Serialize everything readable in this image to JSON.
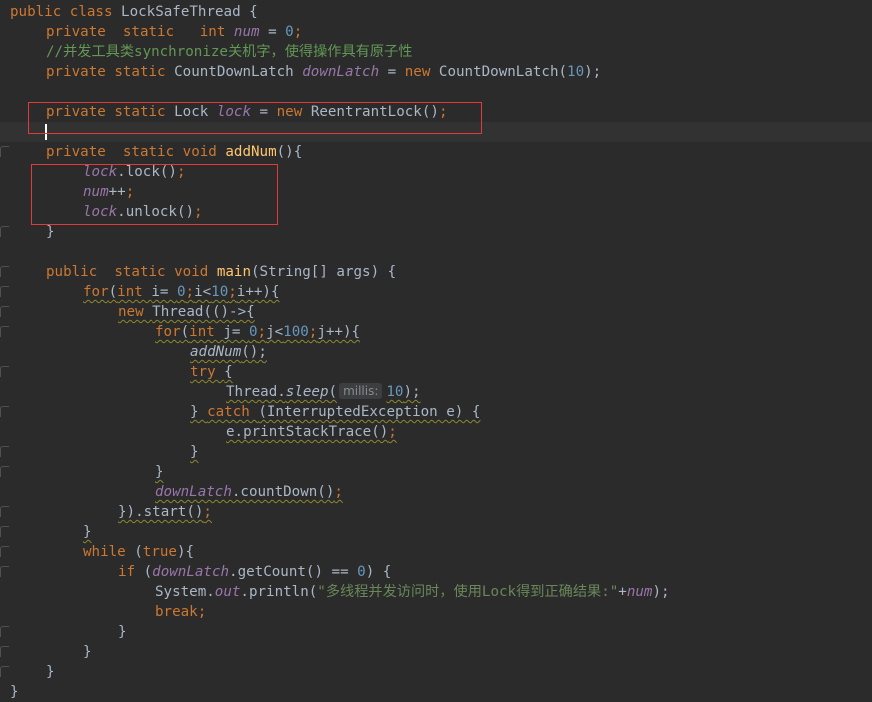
{
  "code": {
    "l1": {
      "a": "public class ",
      "b": "LockSafeThread {"
    },
    "l2": {
      "a": "private  static   int ",
      "b": "num",
      " c": " = ",
      "d": "0",
      "e": ";"
    },
    "l3": {
      "a": "//并发工具类synchronize关机字，使得操作具有原子性"
    },
    "l4": {
      "a": "private static ",
      "b": "CountDownLatch ",
      "c": "downLatch",
      " d": " = ",
      "e": "new ",
      "f": "CountDownLatch(",
      "g": "10",
      "h": ");"
    },
    "l6": {
      "a": "private static ",
      "b": "Lock ",
      "c": "lock",
      " d": " = ",
      "e": "new ",
      "f": "ReentrantLock()",
      "g": ";"
    },
    "l8": {
      "a": "private  static void ",
      "b": "addNum",
      "c": "(){"
    },
    "l9": {
      "a": "lock",
      ".b": ".lock()",
      "c": ";"
    },
    "l10": {
      "a": "num",
      "b": "++",
      "c": ";"
    },
    "l11": {
      "a": "lock",
      "b": ".unlock()",
      "c": ";"
    },
    "l12": {
      "a": "}"
    },
    "l14": {
      "a": "public  static void ",
      "b": "main",
      "c": "(String[] args) {"
    },
    "l15": {
      "a": "for",
      "b": "(",
      "c": "int ",
      "d": "i= ",
      "e": "0",
      ";": ";",
      "f": "i<",
      "g": "10",
      ";2": ";",
      "h": "i++){"
    },
    "l16": {
      "a": "new ",
      "b": "Thread(()->{"
    },
    "l17": {
      "a": "for",
      "b": "(",
      "c": "int ",
      "d": "j= ",
      "e": "0",
      ";": ";",
      "f": "j<",
      "g": "100",
      ";2": ";",
      "h": "j++){"
    },
    "l18": {
      "a": "addNum",
      "b": "();"
    },
    "l19": {
      "a": "try ",
      "b": "{"
    },
    "l20": {
      "a": "Thread.",
      "b": "sleep",
      "c": "(",
      "hint": "millis:",
      "d": "10",
      "e": ");"
    },
    "l21": {
      "a": "} ",
      "b": "catch ",
      "c": "(InterruptedException e) {"
    },
    "l22": {
      "a": "e.printStackTrace()",
      "b": ";"
    },
    "l23": {
      "a": "}"
    },
    "l24": {
      "a": "}"
    },
    "l25": {
      "a": "downLatch",
      "b": ".countDown()",
      "c": ";"
    },
    "l26": {
      "a": "}).start()",
      "b": ";"
    },
    "l27": {
      "a": "}"
    },
    "l28": {
      "a": "while ",
      "b": "(",
      "c": "true",
      "d": "){"
    },
    "l29": {
      "a": "if ",
      "b": "(",
      "c": "downLatch",
      "d": ".getCount() == ",
      "e": "0",
      "f": ") {"
    },
    "l30": {
      "a": "System.",
      "b": "out",
      "c": ".println(",
      "d": "\"多线程并发访问时，使用Lock得到正确结果:\"",
      "e": "+",
      "f": "num",
      "g": ");"
    },
    "l31": {
      "a": "break",
      "b": ";"
    },
    "l32": {
      "a": "}"
    },
    "l33": {
      "a": "}"
    },
    "l34": {
      "a": "}"
    },
    "l35": {
      "a": "}"
    }
  }
}
